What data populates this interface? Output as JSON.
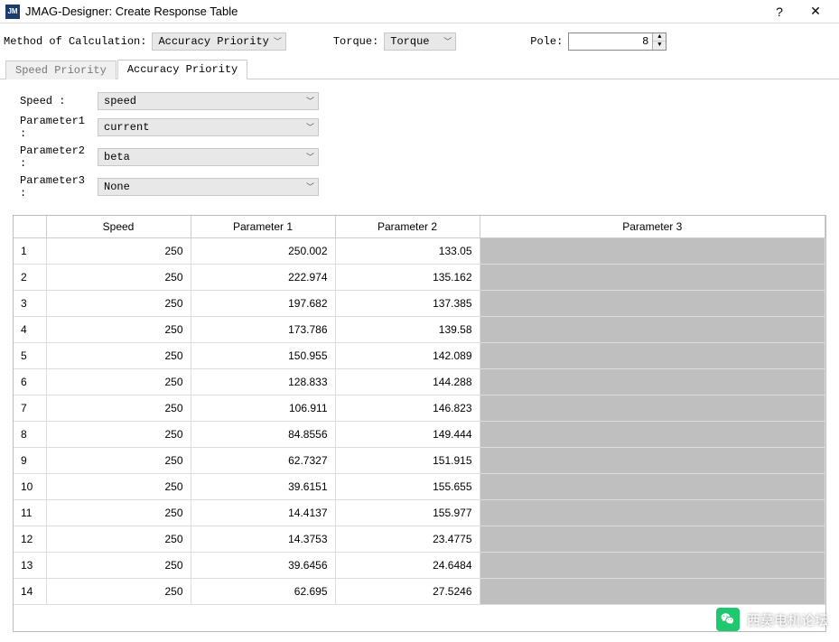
{
  "window": {
    "title": "JMAG-Designer: Create Response Table",
    "help": "?",
    "close": "✕"
  },
  "toolbar": {
    "method_label": "Method of Calculation:",
    "method_value": "Accuracy Priority",
    "torque_label": "Torque:",
    "torque_value": "Torque",
    "pole_label": "Pole:",
    "pole_value": "8"
  },
  "tabs": {
    "tab1": "Speed Priority",
    "tab2": "Accuracy Priority"
  },
  "params": {
    "speed_label": "Speed :",
    "speed_value": "speed",
    "p1_label": "Parameter1 :",
    "p1_value": "current",
    "p2_label": "Parameter2 :",
    "p2_value": "beta",
    "p3_label": "Parameter3 :",
    "p3_value": "None"
  },
  "table": {
    "headers": {
      "idx": "",
      "speed": "Speed",
      "p1": "Parameter 1",
      "p2": "Parameter 2",
      "p3": "Parameter 3"
    },
    "rows": [
      {
        "idx": "1",
        "speed": "250",
        "p1": "250.002",
        "p2": "133.05",
        "p3": ""
      },
      {
        "idx": "2",
        "speed": "250",
        "p1": "222.974",
        "p2": "135.162",
        "p3": ""
      },
      {
        "idx": "3",
        "speed": "250",
        "p1": "197.682",
        "p2": "137.385",
        "p3": ""
      },
      {
        "idx": "4",
        "speed": "250",
        "p1": "173.786",
        "p2": "139.58",
        "p3": ""
      },
      {
        "idx": "5",
        "speed": "250",
        "p1": "150.955",
        "p2": "142.089",
        "p3": ""
      },
      {
        "idx": "6",
        "speed": "250",
        "p1": "128.833",
        "p2": "144.288",
        "p3": ""
      },
      {
        "idx": "7",
        "speed": "250",
        "p1": "106.911",
        "p2": "146.823",
        "p3": ""
      },
      {
        "idx": "8",
        "speed": "250",
        "p1": "84.8556",
        "p2": "149.444",
        "p3": ""
      },
      {
        "idx": "9",
        "speed": "250",
        "p1": "62.7327",
        "p2": "151.915",
        "p3": ""
      },
      {
        "idx": "10",
        "speed": "250",
        "p1": "39.6151",
        "p2": "155.655",
        "p3": ""
      },
      {
        "idx": "11",
        "speed": "250",
        "p1": "14.4137",
        "p2": "155.977",
        "p3": ""
      },
      {
        "idx": "12",
        "speed": "250",
        "p1": "14.3753",
        "p2": "23.4775",
        "p3": ""
      },
      {
        "idx": "13",
        "speed": "250",
        "p1": "39.6456",
        "p2": "24.6484",
        "p3": ""
      },
      {
        "idx": "14",
        "speed": "250",
        "p1": "62.695",
        "p2": "27.5246",
        "p3": ""
      }
    ]
  },
  "watermark": {
    "text": "西莫电机论坛"
  }
}
